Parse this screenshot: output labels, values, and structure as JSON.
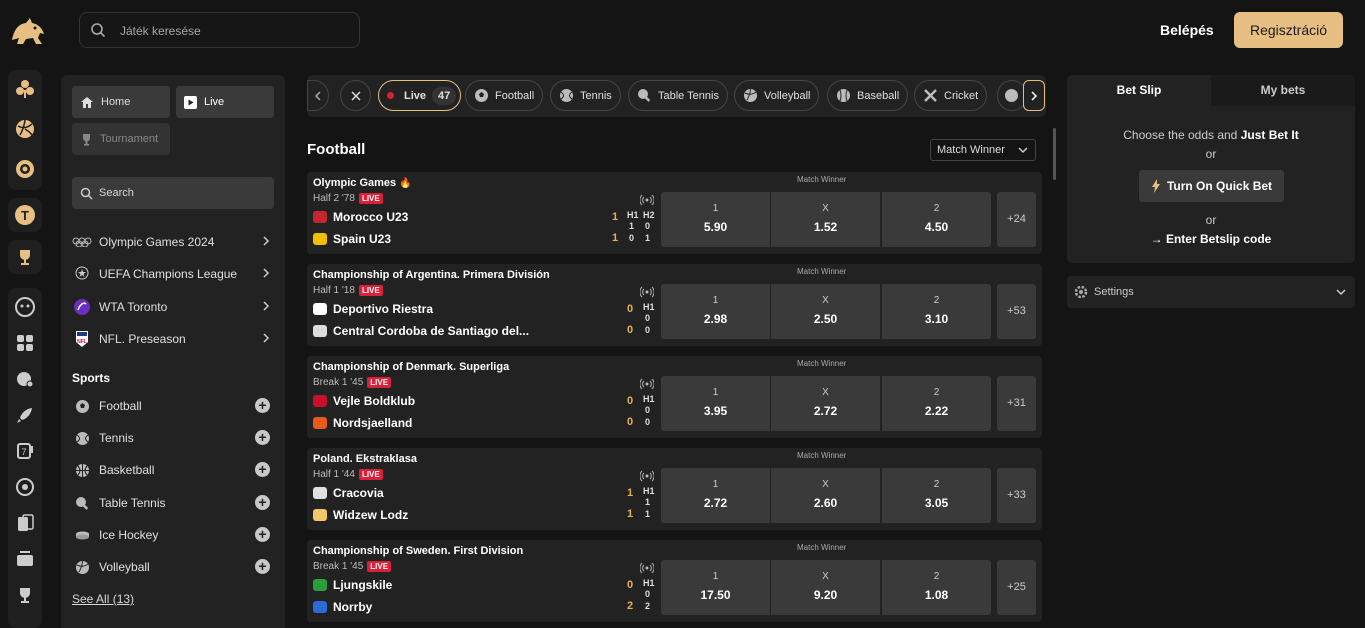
{
  "header": {
    "search_placeholder": "Játék keresése",
    "login": "Belépés",
    "register": "Regisztráció"
  },
  "sidebar": {
    "home": "Home",
    "live": "Live",
    "tournament": "Tournament",
    "search": "Search",
    "competitions": [
      {
        "label": "Olympic Games 2024",
        "icon": "olympic-rings-icon"
      },
      {
        "label": "UEFA Champions League",
        "icon": "champions-league-icon"
      },
      {
        "label": "WTA Toronto",
        "icon": "wta-icon"
      },
      {
        "label": "NFL. Preseason",
        "icon": "nfl-icon"
      }
    ],
    "sports_title": "Sports",
    "sports": [
      {
        "label": "Football",
        "icon": "football-icon"
      },
      {
        "label": "Tennis",
        "icon": "tennis-icon"
      },
      {
        "label": "Basketball",
        "icon": "basketball-icon"
      },
      {
        "label": "Table Tennis",
        "icon": "table-tennis-icon"
      },
      {
        "label": "Ice Hockey",
        "icon": "ice-hockey-icon"
      },
      {
        "label": "Volleyball",
        "icon": "volleyball-icon"
      }
    ],
    "see_all": "See All (13)"
  },
  "filters": {
    "live_label": "Live",
    "live_count": "47",
    "chips": [
      "Football",
      "Tennis",
      "Table Tennis",
      "Volleyball",
      "Baseball",
      "Cricket"
    ]
  },
  "section": {
    "title": "Football",
    "market_select": "Match Winner"
  },
  "matches": [
    {
      "league": "Olympic Games",
      "hot": true,
      "time": "Half 2 '78",
      "live": "LIVE",
      "market": "Match Winner",
      "home": "Morocco U23",
      "away": "Spain U23",
      "home_score": "1",
      "away_score": "1",
      "periods": [
        "H1",
        "H2"
      ],
      "home_p": [
        "1",
        "0"
      ],
      "away_p": [
        "0",
        "1"
      ],
      "labels": [
        "1",
        "X",
        "2"
      ],
      "odds": [
        "5.90",
        "1.52",
        "4.50"
      ],
      "more": "+24"
    },
    {
      "league": "Championship of Argentina. Primera División",
      "hot": false,
      "time": "Half 1 '18",
      "live": "LIVE",
      "market": "Match Winner",
      "home": "Deportivo Riestra",
      "away": "Central Cordoba de Santiago del...",
      "home_score": "0",
      "away_score": "0",
      "periods": [
        "H1"
      ],
      "home_p": [
        "0"
      ],
      "away_p": [
        "0"
      ],
      "labels": [
        "1",
        "X",
        "2"
      ],
      "odds": [
        "2.98",
        "2.50",
        "3.10"
      ],
      "more": "+53"
    },
    {
      "league": "Championship of Denmark. Superliga",
      "hot": false,
      "time": "Break 1 '45",
      "live": "LIVE",
      "market": "Match Winner",
      "home": "Vejle Boldklub",
      "away": "Nordsjaelland",
      "home_score": "0",
      "away_score": "0",
      "periods": [
        "H1"
      ],
      "home_p": [
        "0"
      ],
      "away_p": [
        "0"
      ],
      "labels": [
        "1",
        "X",
        "2"
      ],
      "odds": [
        "3.95",
        "2.72",
        "2.22"
      ],
      "more": "+31"
    },
    {
      "league": "Poland. Ekstraklasa",
      "hot": false,
      "time": "Half 1 '44",
      "live": "LIVE",
      "market": "Match Winner",
      "home": "Cracovia",
      "away": "Widzew Lodz",
      "home_score": "1",
      "away_score": "1",
      "periods": [
        "H1"
      ],
      "home_p": [
        "1"
      ],
      "away_p": [
        "1"
      ],
      "labels": [
        "1",
        "X",
        "2"
      ],
      "odds": [
        "2.72",
        "2.60",
        "3.05"
      ],
      "more": "+33"
    },
    {
      "league": "Championship of Sweden. First Division",
      "hot": false,
      "time": "Break 1 '45",
      "live": "LIVE",
      "market": "Match Winner",
      "home": "Ljungskile",
      "away": "Norrby",
      "home_score": "0",
      "away_score": "2",
      "periods": [
        "H1"
      ],
      "home_p": [
        "0"
      ],
      "away_p": [
        "2"
      ],
      "labels": [
        "1",
        "X",
        "2"
      ],
      "odds": [
        "17.50",
        "9.20",
        "1.08"
      ],
      "more": "+25"
    }
  ],
  "betslip": {
    "tab_active": "Bet Slip",
    "tab_other": "My bets",
    "choose_text": "Choose the odds and",
    "just_bet": "Just Bet It",
    "or1": "or",
    "quick_bet": "Turn On Quick Bet",
    "or2": "or",
    "enter_code": "→ Enter Betslip code"
  },
  "settings": {
    "label": "Settings"
  },
  "colors": {
    "accent": "#e8bf82",
    "live_red": "#d8203a",
    "score": "#e6b050"
  }
}
